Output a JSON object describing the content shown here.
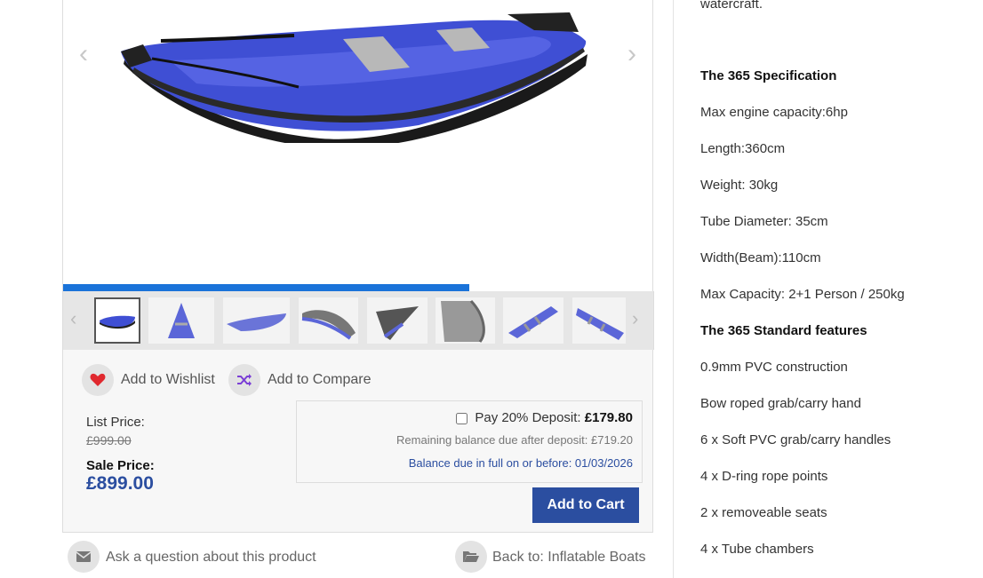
{
  "gallery": {
    "prev_arrow": "‹",
    "next_arrow": "›",
    "progress": 0.69,
    "thumb_count": 8,
    "active_thumb": 1
  },
  "actions": {
    "wishlist_label": "Add to Wishlist",
    "compare_label": "Add to Compare"
  },
  "pricing": {
    "list_label": "List Price:",
    "list_value": "£999.00",
    "sale_label": "Sale Price:",
    "sale_value": "£899.00"
  },
  "deposit": {
    "checkbox_label": "Pay 20% Deposit:",
    "deposit_amount": "£179.80",
    "remaining_text": "Remaining balance due after deposit: £719.20",
    "due_text": "Balance due in full on or before: 01/03/2026",
    "checked": false
  },
  "cart": {
    "add_label": "Add to Cart"
  },
  "footer_links": {
    "ask_label": "Ask a question about this product",
    "back_label": "Back to: Inflatable Boats"
  },
  "specs": {
    "cut_text": "watercraft.",
    "spec_title": "The 365 Specification",
    "spec_items": [
      "Max engine capacity:6hp",
      "Length:360cm",
      "Weight: 30kg",
      "Tube Diameter: 35cm",
      "Width(Beam):110cm",
      "Max Capacity: 2+1 Person / 250kg"
    ],
    "features_title": "The 365 Standard features",
    "feature_items": [
      "0.9mm PVC construction",
      "Bow roped grab/carry hand",
      "6 x Soft PVC grab/carry handles",
      "4 x D-ring rope points",
      "2 x removeable seats",
      "4 x Tube chambers"
    ]
  },
  "colors": {
    "accent": "#2b4ea0",
    "progress": "#1a73d9",
    "sale_price": "#2b4ea0",
    "due_text": "#2b4ea0",
    "heart": "#e0282e",
    "shuffle": "#7b3fd6"
  },
  "icons": [
    "chevron-left-icon",
    "chevron-right-icon",
    "heart-icon",
    "shuffle-icon",
    "envelope-icon",
    "folder-open-icon"
  ]
}
